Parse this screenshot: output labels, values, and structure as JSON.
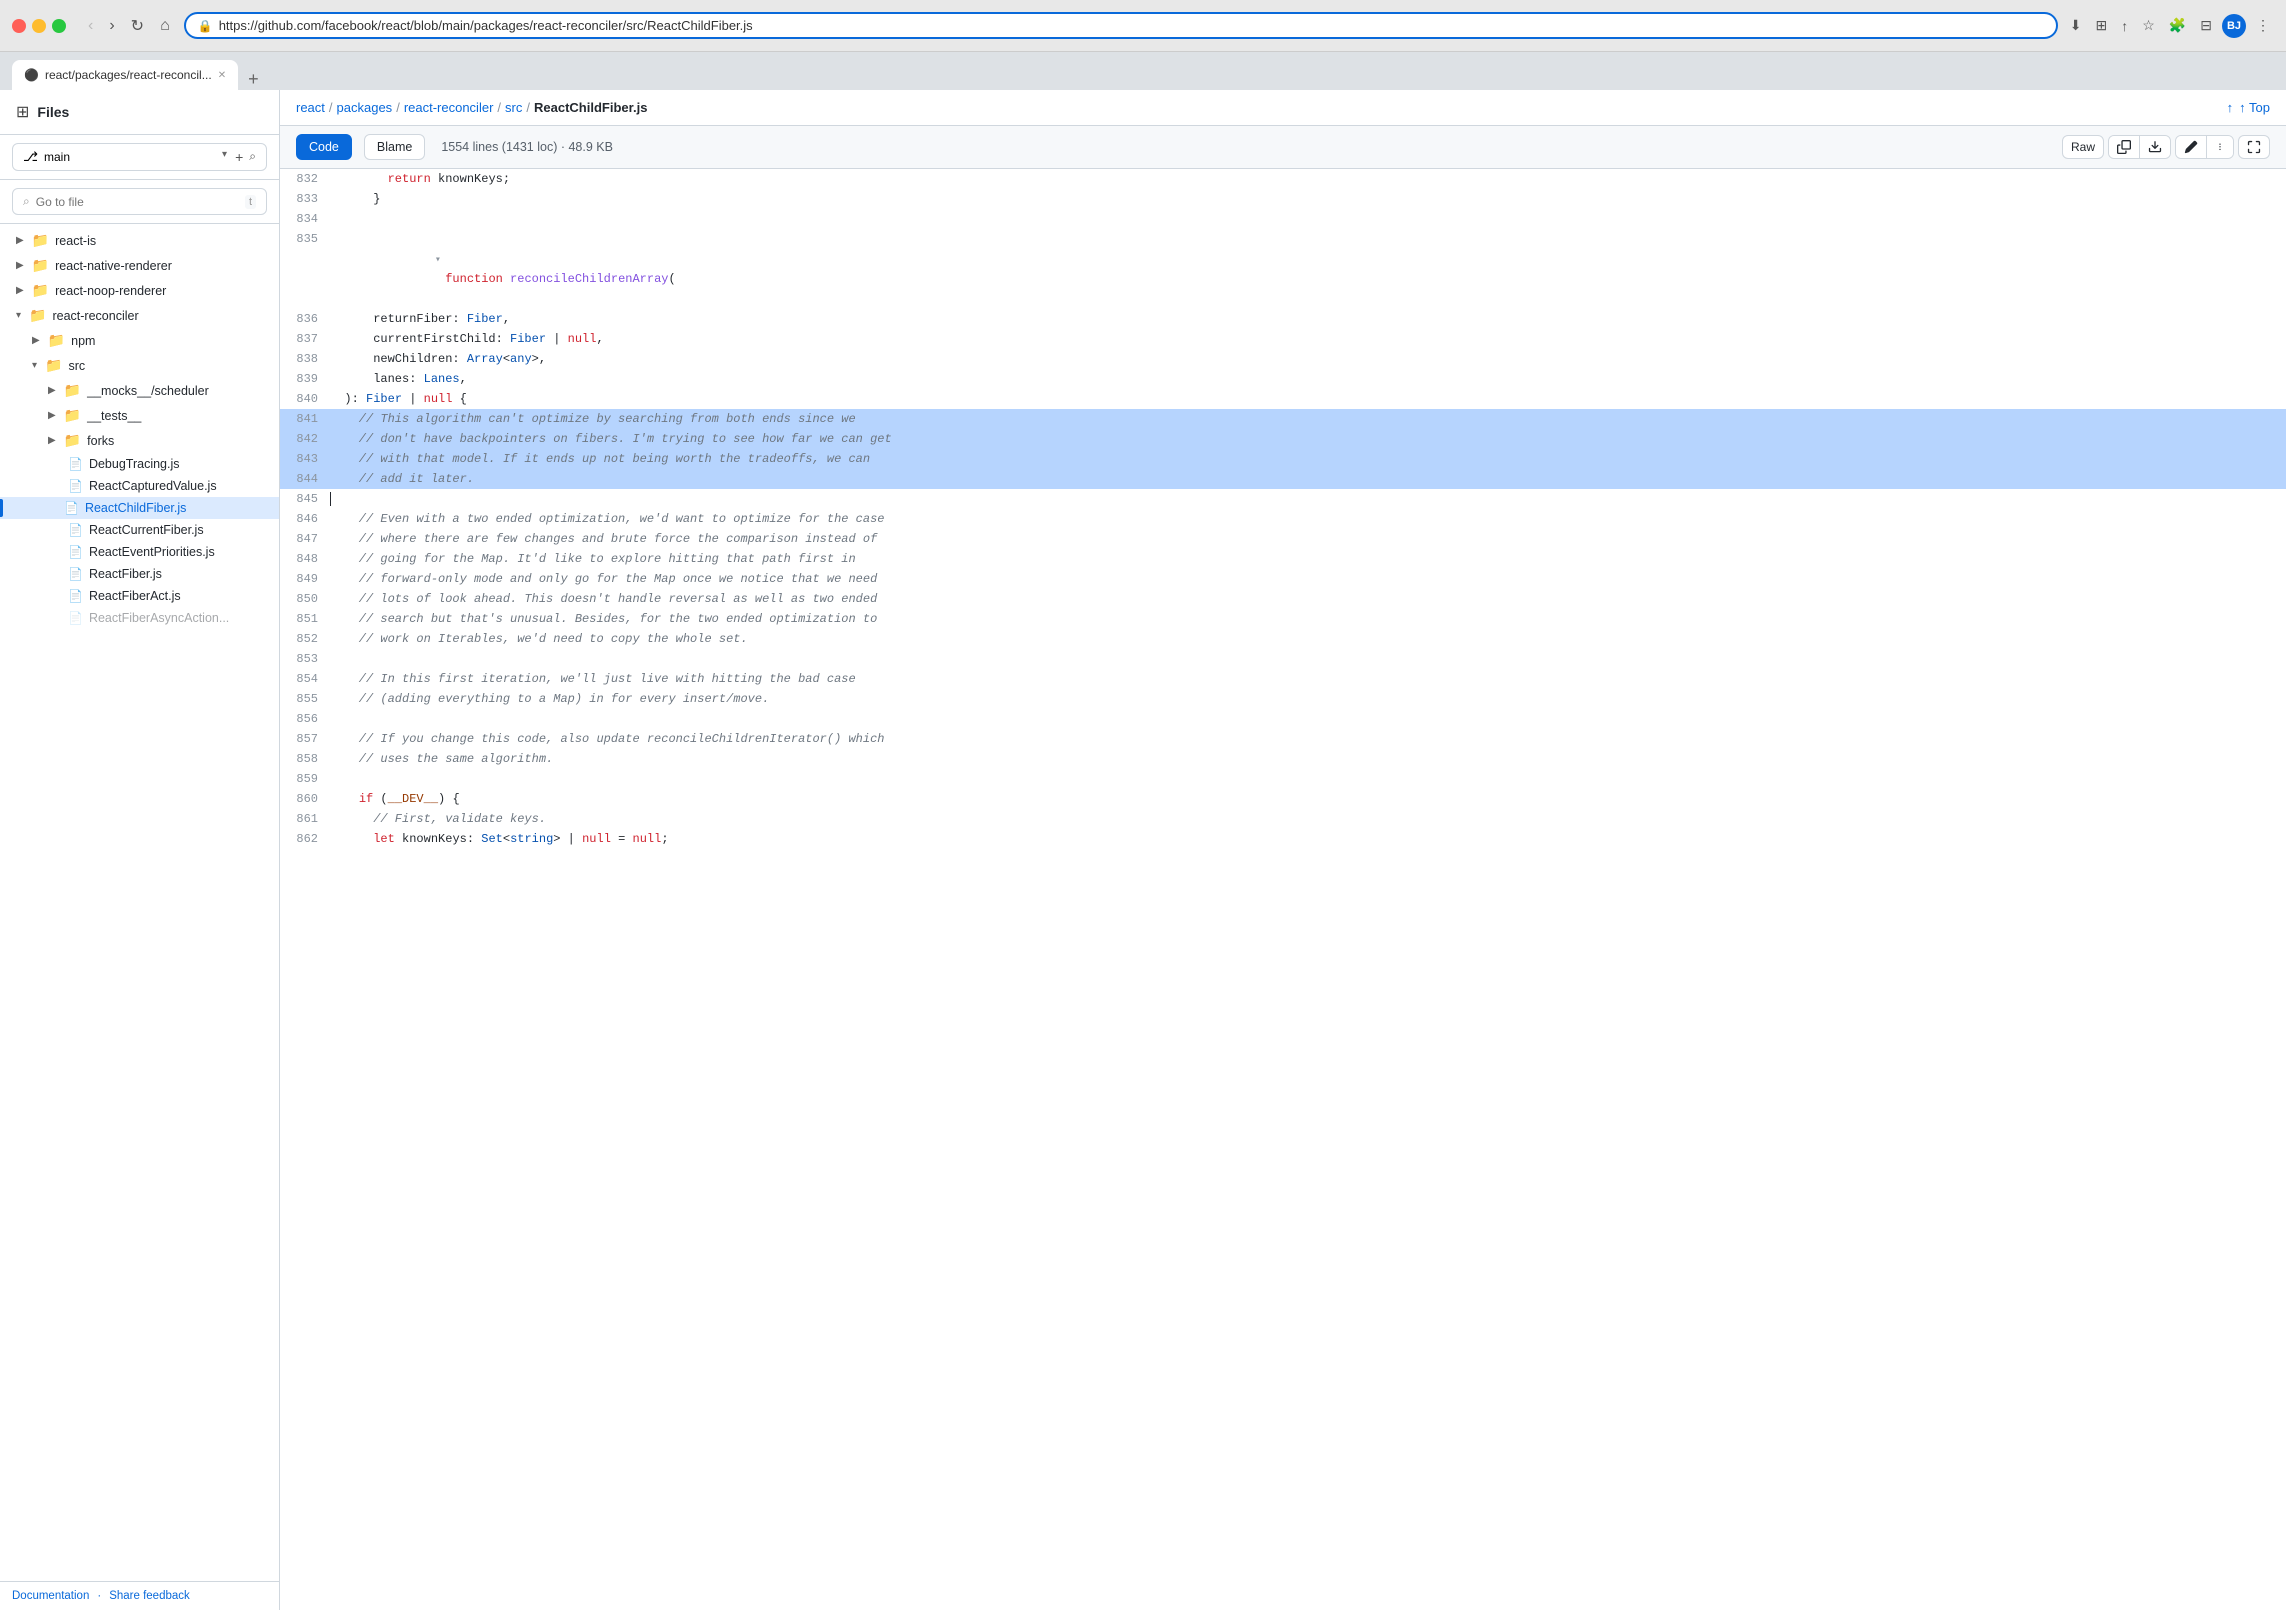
{
  "browser": {
    "url": "https://github.com/facebook/react/blob/main/packages/react-reconciler/src/ReactChildFiber.js",
    "tab_title": "react/packages/react-reconcil...",
    "tab_github_icon": "github"
  },
  "breadcrumb": {
    "parts": [
      "react",
      "/",
      "packages",
      "/",
      "react-reconciler",
      "/",
      "src",
      "/"
    ],
    "current": "ReactChildFiber.js"
  },
  "top_button": "↑ Top",
  "file_info": {
    "lines": "1554 lines (1431 loc)",
    "size": "48.9 KB",
    "code_tab": "Code",
    "blame_tab": "Blame"
  },
  "toolbar": {
    "raw": "Raw",
    "copy_icon": "copy",
    "download_icon": "download",
    "edit_icon": "edit",
    "chevron_icon": "chevron-down",
    "fullscreen_icon": "fullscreen"
  },
  "sidebar": {
    "title": "Files",
    "search_placeholder": "Go to file",
    "search_shortcut": "t",
    "branch": "main",
    "footer_links": [
      "Documentation",
      "Share feedback"
    ]
  },
  "tree": [
    {
      "id": "react-is",
      "label": "react-is",
      "type": "folder",
      "level": 0,
      "expanded": false
    },
    {
      "id": "react-native-renderer",
      "label": "react-native-renderer",
      "type": "folder",
      "level": 0,
      "expanded": false
    },
    {
      "id": "react-noop-renderer",
      "label": "react-noop-renderer",
      "type": "folder",
      "level": 0,
      "expanded": false
    },
    {
      "id": "react-reconciler",
      "label": "react-reconciler",
      "type": "folder",
      "level": 0,
      "expanded": true
    },
    {
      "id": "npm",
      "label": "npm",
      "type": "folder",
      "level": 1,
      "expanded": false
    },
    {
      "id": "src",
      "label": "src",
      "type": "folder",
      "level": 1,
      "expanded": true
    },
    {
      "id": "mocks-scheduler",
      "label": "__mocks__/scheduler",
      "type": "folder",
      "level": 2,
      "expanded": false
    },
    {
      "id": "tests",
      "label": "__tests__",
      "type": "folder",
      "level": 2,
      "expanded": false
    },
    {
      "id": "forks",
      "label": "forks",
      "type": "folder",
      "level": 2,
      "expanded": false
    },
    {
      "id": "DebugTracing",
      "label": "DebugTracing.js",
      "type": "file",
      "level": 2,
      "expanded": false
    },
    {
      "id": "ReactCapturedValue",
      "label": "ReactCapturedValue.js",
      "type": "file",
      "level": 2,
      "expanded": false
    },
    {
      "id": "ReactChildFiber",
      "label": "ReactChildFiber.js",
      "type": "file",
      "level": 2,
      "active": true
    },
    {
      "id": "ReactCurrentFiber",
      "label": "ReactCurrentFiber.js",
      "type": "file",
      "level": 2
    },
    {
      "id": "ReactEventPriorities",
      "label": "ReactEventPriorities.js",
      "type": "file",
      "level": 2
    },
    {
      "id": "ReactFiber",
      "label": "ReactFiber.js",
      "type": "file",
      "level": 2
    },
    {
      "id": "ReactFiberAct",
      "label": "ReactFiberAct.js",
      "type": "file",
      "level": 2
    }
  ],
  "code": {
    "lines": [
      {
        "num": 832,
        "content": "        return knownKeys;",
        "highlighted": false
      },
      {
        "num": 833,
        "content": "      }",
        "highlighted": false
      },
      {
        "num": 834,
        "content": "",
        "highlighted": false
      },
      {
        "num": 835,
        "content": "  function reconcileChildrenArray(",
        "highlighted": false,
        "collapsible": true,
        "keyword": "function",
        "fn_name": "reconcileChildrenArray"
      },
      {
        "num": 836,
        "content": "      returnFiber: Fiber,",
        "highlighted": false
      },
      {
        "num": 837,
        "content": "      currentFirstChild: Fiber | null,",
        "highlighted": false
      },
      {
        "num": 838,
        "content": "      newChildren: Array<any>,",
        "highlighted": false
      },
      {
        "num": 839,
        "content": "      lanes: Lanes,",
        "highlighted": false
      },
      {
        "num": 840,
        "content": "  ): Fiber | null {",
        "highlighted": false
      },
      {
        "num": 841,
        "content": "    // This algorithm can't optimize by searching from both ends since we",
        "highlighted": true,
        "type": "comment"
      },
      {
        "num": 842,
        "content": "    // don't have backpointers on fibers. I'm trying to see how far we can get",
        "highlighted": true,
        "type": "comment"
      },
      {
        "num": 843,
        "content": "    // with that model. If it ends up not being worth the tradeoffs, we can",
        "highlighted": true,
        "type": "comment"
      },
      {
        "num": 844,
        "content": "    // add it later.",
        "highlighted": true,
        "type": "comment"
      },
      {
        "num": 845,
        "content": "",
        "highlighted": false
      },
      {
        "num": 846,
        "content": "    // Even with a two ended optimization, we'd want to optimize for the case",
        "highlighted": false,
        "type": "comment"
      },
      {
        "num": 847,
        "content": "    // where there are few changes and brute force the comparison instead of",
        "highlighted": false,
        "type": "comment"
      },
      {
        "num": 848,
        "content": "    // going for the Map. It'd like to explore hitting that path first in",
        "highlighted": false,
        "type": "comment"
      },
      {
        "num": 849,
        "content": "    // forward-only mode and only go for the Map once we notice that we need",
        "highlighted": false,
        "type": "comment"
      },
      {
        "num": 850,
        "content": "    // lots of look ahead. This doesn't handle reversal as well as two ended",
        "highlighted": false,
        "type": "comment"
      },
      {
        "num": 851,
        "content": "    // search but that's unusual. Besides, for the two ended optimization to",
        "highlighted": false,
        "type": "comment"
      },
      {
        "num": 852,
        "content": "    // work on Iterables, we'd need to copy the whole set.",
        "highlighted": false,
        "type": "comment"
      },
      {
        "num": 853,
        "content": "",
        "highlighted": false
      },
      {
        "num": 854,
        "content": "    // In this first iteration, we'll just live with hitting the bad case",
        "highlighted": false,
        "type": "comment"
      },
      {
        "num": 855,
        "content": "    // (adding everything to a Map) in for every insert/move.",
        "highlighted": false,
        "type": "comment"
      },
      {
        "num": 856,
        "content": "",
        "highlighted": false
      },
      {
        "num": 857,
        "content": "    // If you change this code, also update reconcileChildrenIterator() which",
        "highlighted": false,
        "type": "comment"
      },
      {
        "num": 858,
        "content": "    // uses the same algorithm.",
        "highlighted": false,
        "type": "comment"
      },
      {
        "num": 859,
        "content": "",
        "highlighted": false
      },
      {
        "num": 860,
        "content": "    if (__DEV__) {",
        "highlighted": false
      },
      {
        "num": 861,
        "content": "      // First, validate keys.",
        "highlighted": false,
        "type": "comment"
      },
      {
        "num": 862,
        "content": "      let knownKeys: Set<string> | null = null;",
        "highlighted": false
      }
    ]
  }
}
